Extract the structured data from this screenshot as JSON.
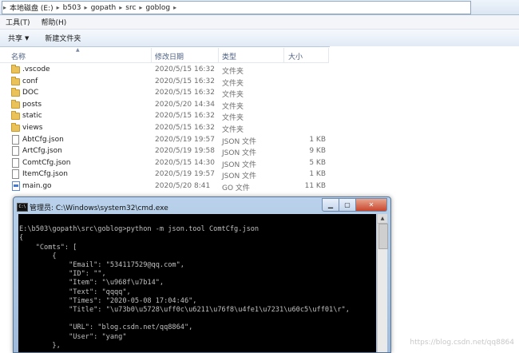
{
  "address_bar": {
    "crumbs": [
      "本地磁盘 (E:)",
      "b503",
      "gopath",
      "src",
      "goblog"
    ]
  },
  "menu": {
    "items": [
      "工具(T)",
      "帮助(H)"
    ]
  },
  "toolbar": {
    "share_label": "共享",
    "new_folder_label": "新建文件夹"
  },
  "columns": {
    "name": "名称",
    "modified": "修改日期",
    "type": "类型",
    "size": "大小"
  },
  "files": [
    {
      "name": ".vscode",
      "date": "2020/5/15 16:32",
      "type": "文件夹",
      "size": "",
      "icon": "folder-icon"
    },
    {
      "name": "conf",
      "date": "2020/5/15 16:32",
      "type": "文件夹",
      "size": "",
      "icon": "folder-icon"
    },
    {
      "name": "DOC",
      "date": "2020/5/15 16:32",
      "type": "文件夹",
      "size": "",
      "icon": "folder-icon"
    },
    {
      "name": "posts",
      "date": "2020/5/20 14:34",
      "type": "文件夹",
      "size": "",
      "icon": "folder-icon"
    },
    {
      "name": "static",
      "date": "2020/5/15 16:32",
      "type": "文件夹",
      "size": "",
      "icon": "folder-icon"
    },
    {
      "name": "views",
      "date": "2020/5/15 16:32",
      "type": "文件夹",
      "size": "",
      "icon": "folder-icon"
    },
    {
      "name": "AbtCfg.json",
      "date": "2020/5/19 19:57",
      "type": "JSON 文件",
      "size": "1 KB",
      "icon": "file-icon"
    },
    {
      "name": "ArtCfg.json",
      "date": "2020/5/19 19:58",
      "type": "JSON 文件",
      "size": "9 KB",
      "icon": "file-icon"
    },
    {
      "name": "ComtCfg.json",
      "date": "2020/5/15 14:30",
      "type": "JSON 文件",
      "size": "5 KB",
      "icon": "file-icon"
    },
    {
      "name": "ItemCfg.json",
      "date": "2020/5/19 19:57",
      "type": "JSON 文件",
      "size": "1 KB",
      "icon": "file-icon"
    },
    {
      "name": "main.go",
      "date": "2020/5/20 8:41",
      "type": "GO 文件",
      "size": "11 KB",
      "icon": "go-file-icon"
    }
  ],
  "cmd": {
    "title": "管理员: C:\\Windows\\system32\\cmd.exe",
    "icon_label": "C:\\",
    "lines": [
      "",
      "E:\\b503\\gopath\\src\\goblog>python -m json.tool ComtCfg.json",
      "{",
      "    \"Comts\": [",
      "        {",
      "            \"Email\": \"534117529@qq.com\",",
      "            \"ID\": \"\",",
      "            \"Item\": \"\\u968f\\u7b14\",",
      "            \"Text\": \"qqqq\",",
      "            \"Times\": \"2020-05-08 17:04:46\",",
      "            \"Title\": \"\\u73b0\\u5728\\uff0c\\u6211\\u76f8\\u4fe1\\u7231\\u60c5\\uff01\\r\",",
      "",
      "            \"URL\": \"blog.csdn.net/qq8864\",",
      "            \"User\": \"yang\"",
      "        },"
    ]
  },
  "watermark": "https://blog.csdn.net/qq8864"
}
